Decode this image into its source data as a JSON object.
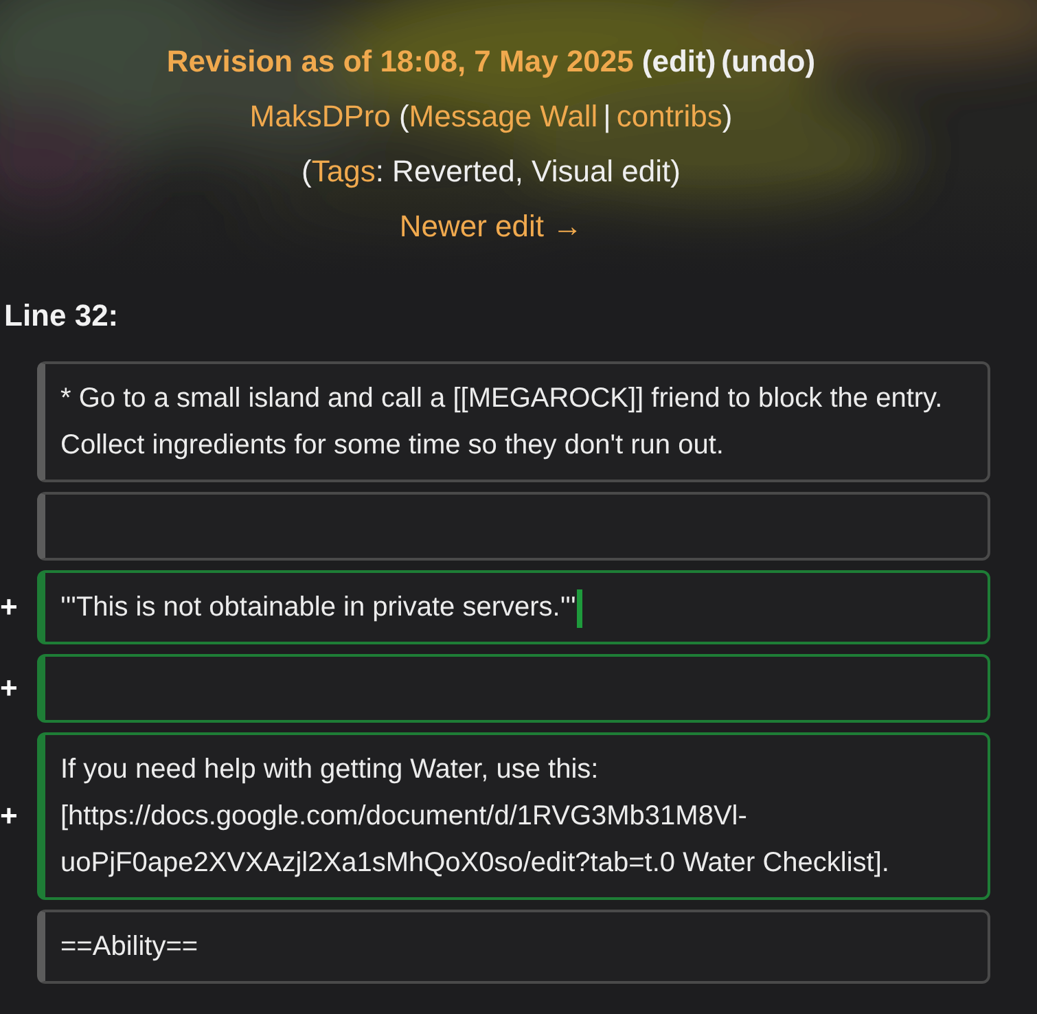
{
  "header": {
    "revision_title": "Revision as of 18:08, 7 May 2025",
    "edit_link": "(edit)",
    "undo_link": "(undo)",
    "user_link": "MaksDPro",
    "open_paren": "(",
    "message_wall_link": "Message Wall",
    "separator": "|",
    "contribs_link": "contribs",
    "close_paren": ")",
    "tags_open": "(",
    "tags_link": "Tags",
    "tags_text": ": Reverted, Visual edit)",
    "newer_edit_link": "Newer edit →"
  },
  "diff": {
    "line_label": "Line 32:",
    "rows": [
      {
        "kind": "context",
        "marker": "",
        "text": "* Go to a small island and call a [[MEGAROCK]] friend to block the entry. Collect ingredients for some time so they don't run out.",
        "trailing_mark": false
      },
      {
        "kind": "context",
        "marker": "",
        "text": "",
        "trailing_mark": false
      },
      {
        "kind": "added",
        "marker": "+",
        "text": "'''This is not obtainable in private servers.'''",
        "trailing_mark": true
      },
      {
        "kind": "added",
        "marker": "+",
        "text": "",
        "trailing_mark": false
      },
      {
        "kind": "added",
        "marker": "+",
        "text": "If you need help with getting Water, use this: [https://docs.google.com/document/d/1RVG3Mb31M8Vl-uoPjF0ape2XVXAzjl2Xa1sMhQoX0so/edit?tab=t.0 Water Checklist].",
        "trailing_mark": false
      },
      {
        "kind": "context",
        "marker": "",
        "text": "==Ability==",
        "trailing_mark": false
      }
    ]
  }
}
